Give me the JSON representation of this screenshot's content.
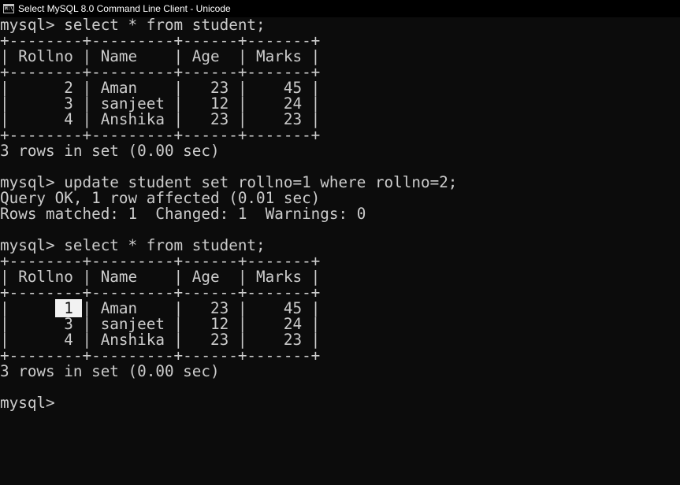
{
  "window": {
    "title": "Select MySQL 8.0 Command Line Client - Unicode",
    "icon": "console-icon",
    "icon_text": "M:\\"
  },
  "console": {
    "lines": [
      "mysql> select * from student;",
      "+--------+---------+------+-------+",
      "| Rollno | Name    | Age  | Marks |",
      "+--------+---------+------+-------+",
      "|      2 | Aman    |   23 |    45 |",
      "|      3 | sanjeet |   12 |    24 |",
      "|      4 | Anshika |   23 |    23 |",
      "+--------+---------+------+-------+",
      "3 rows in set (0.00 sec)",
      "",
      "mysql> update student set rollno=1 where rollno=2;",
      "Query OK, 1 row affected (0.01 sec)",
      "Rows matched: 1  Changed: 1  Warnings: 0",
      "",
      "mysql> select * from student;",
      "+--------+---------+------+-------+",
      "| Rollno | Name    | Age  | Marks |",
      "+--------+---------+------+-------+"
    ],
    "selected_row": {
      "before": "|     ",
      "selection": " 1 ",
      "after": "| Aman    |   23 |    45 |"
    },
    "lines_after": [
      "|      3 | sanjeet |   12 |    24 |",
      "|      4 | Anshika |   23 |    23 |",
      "+--------+---------+------+-------+",
      "3 rows in set (0.00 sec)",
      "",
      "mysql>"
    ]
  }
}
